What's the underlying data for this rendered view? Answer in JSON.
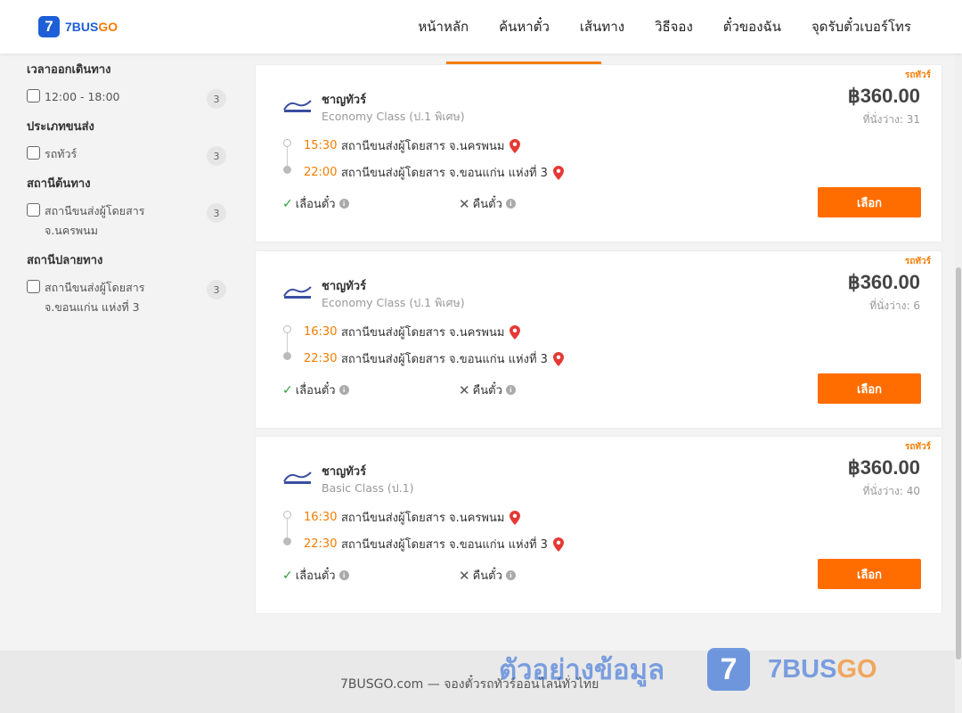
{
  "header": {
    "logo_number": "7",
    "logo_blue": "7BUS",
    "logo_orange": "GO",
    "nav": [
      "หน้าหลัก",
      "ค้นหาตั๋ว",
      "เส้นทาง",
      "วิธีจอง",
      "ตั๋วของฉัน",
      "จุดรับตั๋วเบอร์โทร"
    ]
  },
  "filters": [
    {
      "title": "เวลาออกเดินทาง",
      "options": [
        {
          "label": "12:00 - 18:00",
          "count": "3"
        }
      ]
    },
    {
      "title": "ประเภทขนส่ง",
      "options": [
        {
          "label": "รถทัวร์",
          "count": "3"
        }
      ]
    },
    {
      "title": "สถานีต้นทาง",
      "options": [
        {
          "label": "สถานีขนส่งผู้โดยสาร จ.นครพนม",
          "count": "3"
        }
      ]
    },
    {
      "title": "สถานีปลายทาง",
      "options": [
        {
          "label": "สถานีขนส่งผู้โดยสาร จ.ขอนแก่น แห่งที่ 3",
          "count": "3"
        }
      ]
    }
  ],
  "results": [
    {
      "ribbon": "รถทัวร์",
      "operator": "ชาญทัวร์",
      "class": "Economy Class (ป.1 พิเศษ)",
      "price": "฿360.00",
      "seats": "ที่นั่งว่าง: 31",
      "depart_time": "15:30",
      "depart_station": "สถานีขนส่งผู้โดยสาร จ.นครพนม",
      "arrive_time": "22:00",
      "arrive_station": "สถานีขนส่งผู้โดยสาร จ.ขอนแก่น แห่งที่ 3",
      "reschedule": "เลื่อนตั๋ว",
      "refund": "คืนตั๋ว",
      "select": "เลือก"
    },
    {
      "ribbon": "รถทัวร์",
      "operator": "ชาญทัวร์",
      "class": "Economy Class (ป.1 พิเศษ)",
      "price": "฿360.00",
      "seats": "ที่นั่งว่าง: 6",
      "depart_time": "16:30",
      "depart_station": "สถานีขนส่งผู้โดยสาร จ.นครพนม",
      "arrive_time": "22:30",
      "arrive_station": "สถานีขนส่งผู้โดยสาร จ.ขอนแก่น แห่งที่ 3",
      "reschedule": "เลื่อนตั๋ว",
      "refund": "คืนตั๋ว",
      "select": "เลือก"
    },
    {
      "ribbon": "รถทัวร์",
      "operator": "ชาญทัวร์",
      "class": "Basic Class (ป.1)",
      "price": "฿360.00",
      "seats": "ที่นั่งว่าง: 40",
      "depart_time": "16:30",
      "depart_station": "สถานีขนส่งผู้โดยสาร จ.นครพนม",
      "arrive_time": "22:30",
      "arrive_station": "สถานีขนส่งผู้โดยสาร จ.ขอนแก่น แห่งที่ 3",
      "reschedule": "เลื่อนตั๋ว",
      "refund": "คืนตั๋ว",
      "select": "เลือก"
    }
  ],
  "footer": {
    "text": "7BUSGO.com — จองตั๋วรถทัวร์ออนไลน์ทั่วไทย"
  },
  "watermark": {
    "text": "ตัวอย่างข้อมูล",
    "logo_number": "7",
    "brand_blue": "7BUS",
    "brand_orange": "GO"
  },
  "colors": {
    "accent": "#ff6d00",
    "brand_blue": "#1d5fd6",
    "time": "#f57c00",
    "pin": "#e53935",
    "check": "#2e9d3a"
  }
}
